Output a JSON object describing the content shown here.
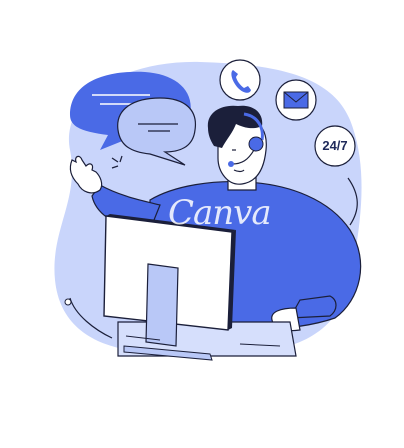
{
  "icons": {
    "phone": "phone-icon",
    "mail": "mail-icon",
    "support_hours": "24-7-badge"
  },
  "badge": {
    "label": "24/7"
  },
  "watermark": {
    "text": "Canva"
  },
  "colors": {
    "blob": "#c9d5fb",
    "accent_blue": "#4a6ae6",
    "light_blue": "#b9c8f7",
    "outline": "#1b1f3a",
    "white": "#ffffff"
  }
}
